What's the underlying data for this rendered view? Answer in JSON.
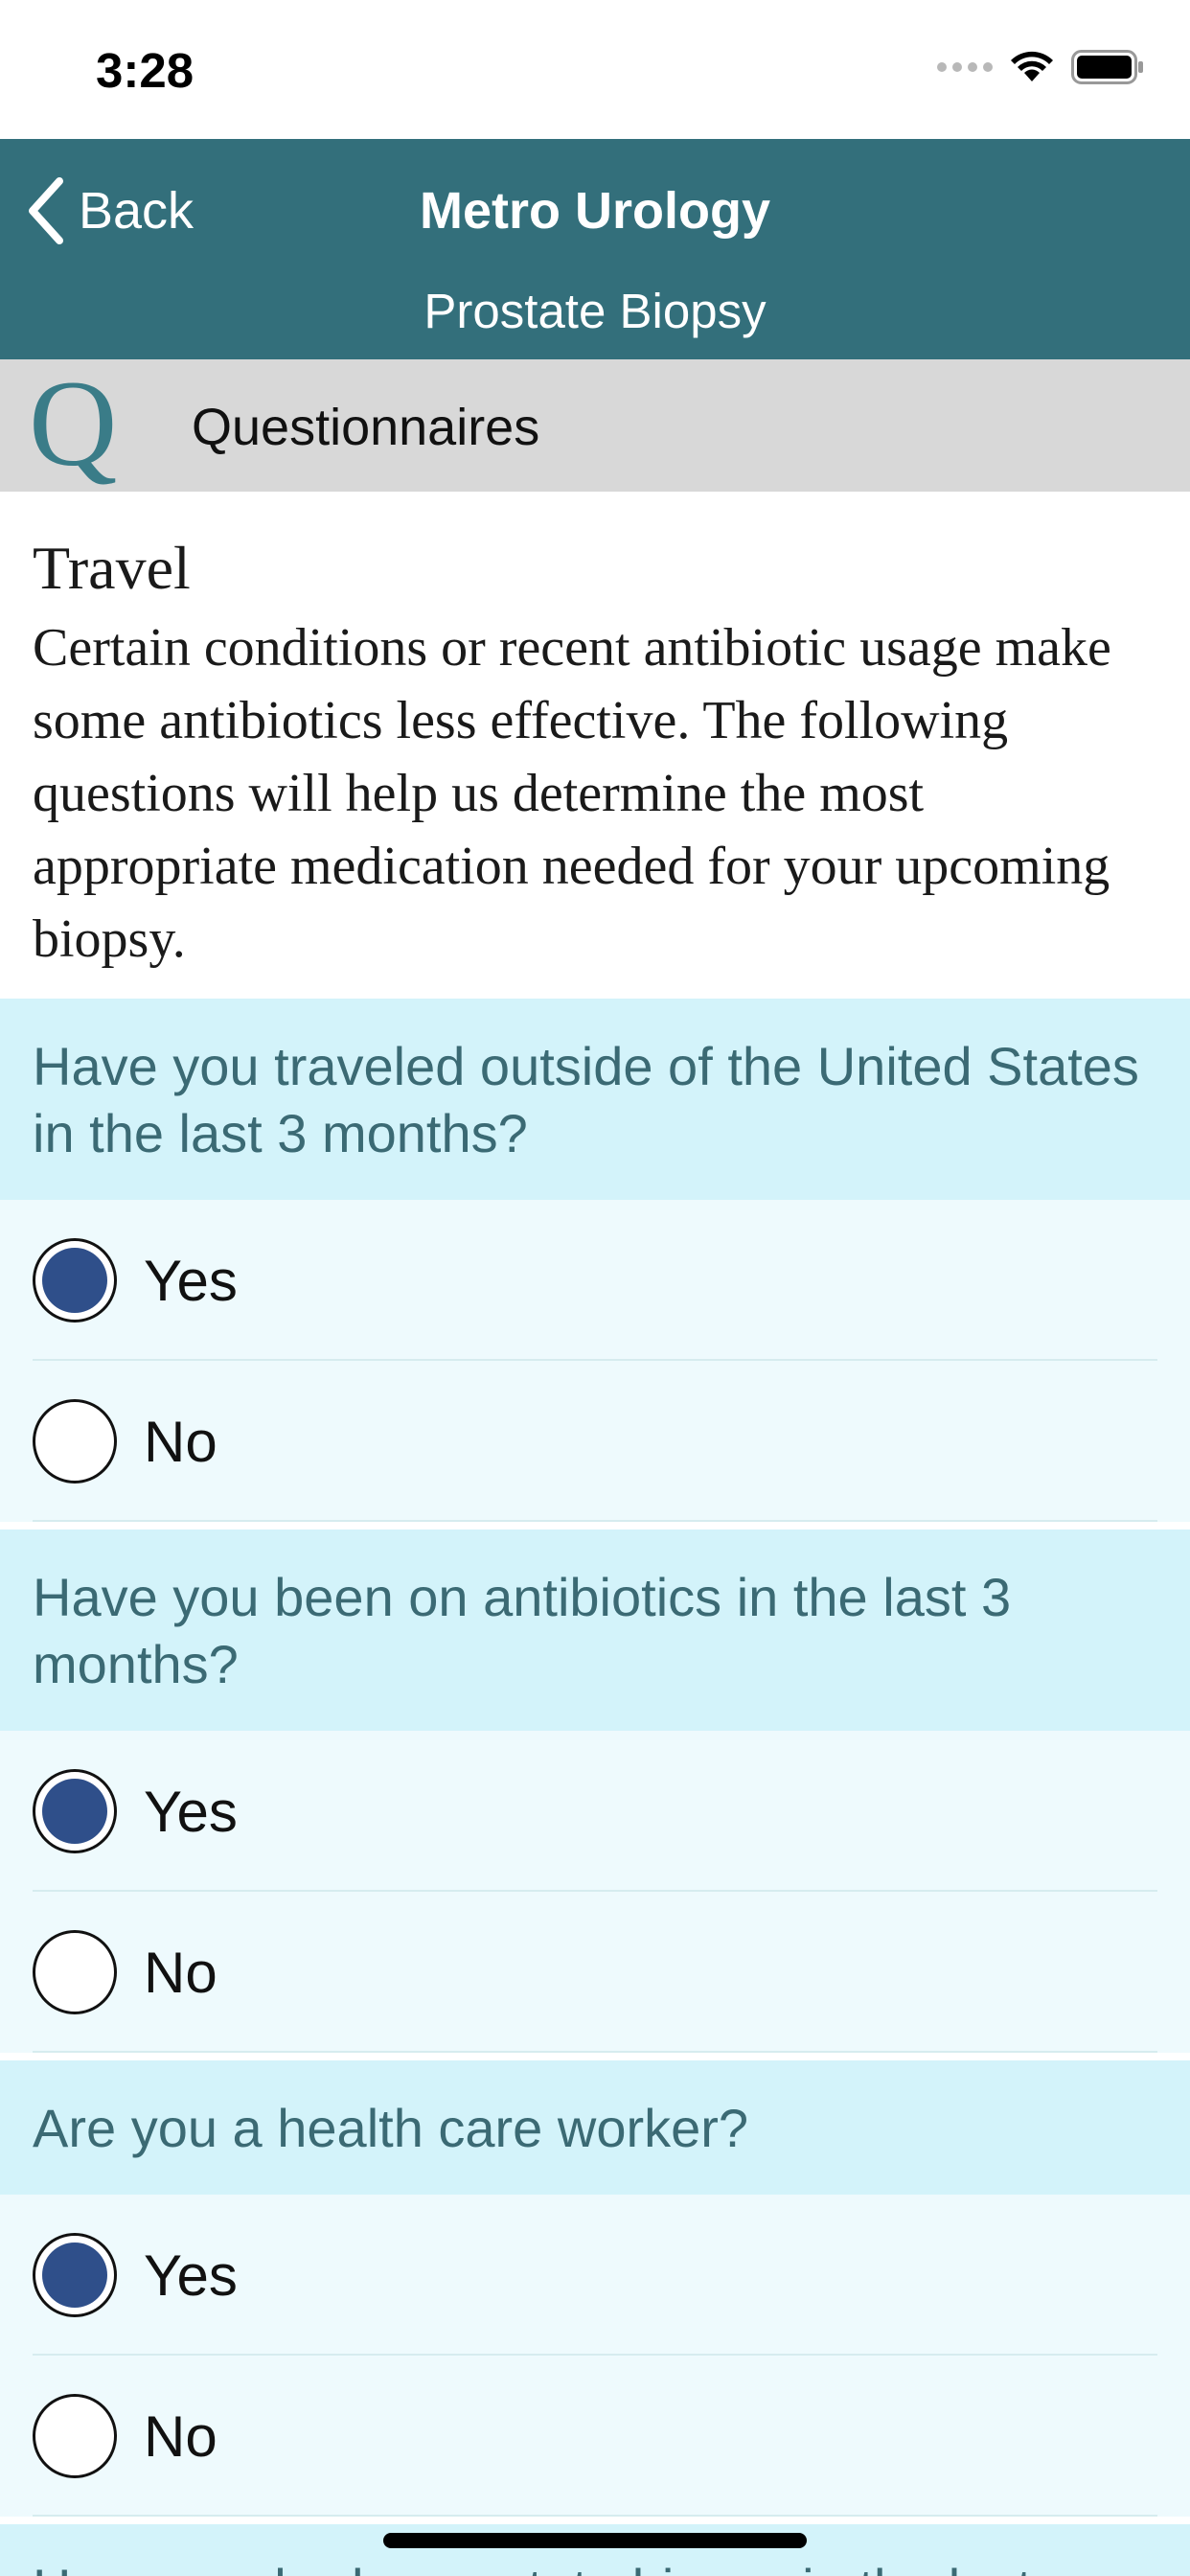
{
  "status_bar": {
    "time": "3:28"
  },
  "nav": {
    "back_label": "Back",
    "title": "Metro Urology",
    "subtitle": "Prostate Biopsy"
  },
  "section": {
    "logo_letter": "Q",
    "title": "Questionnaires"
  },
  "intro": {
    "title": "Travel",
    "text": "Certain conditions or recent antibiotic usage make some antibiotics less effective. The following questions will help us determine the most appropriate medication needed for your upcoming biopsy."
  },
  "questions": [
    {
      "text": "Have you traveled outside of the United States in the last 3 months?",
      "options": [
        {
          "label": "Yes",
          "selected": true
        },
        {
          "label": "No",
          "selected": false
        }
      ]
    },
    {
      "text": "Have you been on antibiotics in the last 3 months?",
      "options": [
        {
          "label": "Yes",
          "selected": true
        },
        {
          "label": "No",
          "selected": false
        }
      ]
    },
    {
      "text": "Are you a health care worker?",
      "options": [
        {
          "label": "Yes",
          "selected": true
        },
        {
          "label": "No",
          "selected": false
        }
      ]
    }
  ],
  "partial_question": "Have you had a prostate biopsy in the last",
  "colors": {
    "nav_background": "#336f7b",
    "question_header_bg": "#d3f3fa",
    "options_bg": "#eefafd",
    "radio_selected": "#2f4f8a"
  },
  "icons": {
    "back": "chevron-left-icon",
    "wifi": "wifi-icon",
    "battery": "battery-icon",
    "signal": "cellular-signal-icon"
  }
}
